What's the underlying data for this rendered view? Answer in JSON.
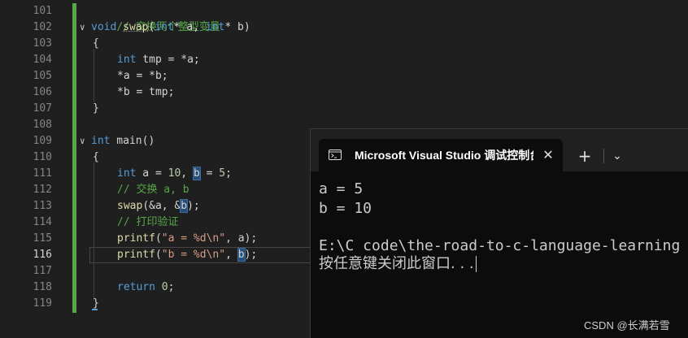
{
  "editor": {
    "line_numbers": [
      "101",
      "102",
      "103",
      "104",
      "105",
      "106",
      "107",
      "108",
      "109",
      "110",
      "111",
      "112",
      "113",
      "114",
      "115",
      "116",
      "117",
      "118",
      "119"
    ],
    "active_line": "116",
    "lines": {
      "l101": {
        "comment": "// 交换两个整型变量"
      },
      "l102": {
        "kw": "void",
        "fn": "swap",
        "params_open": "(",
        "kw2": "int",
        "p1": "* a, ",
        "kw3": "int",
        "p2": "* b)"
      },
      "l103": "{",
      "l104": {
        "kw": "int",
        "rest": " tmp = *a;"
      },
      "l105": "*a = *b;",
      "l106": "*b = tmp;",
      "l107": "}",
      "l109": {
        "kw": "int",
        "rest": " main()"
      },
      "l110": "{",
      "l111": {
        "kw": "int",
        "a_decl": " a = ",
        "num10": "10",
        "sep": ", ",
        "b_var": "b",
        "eq": " = ",
        "num5": "5",
        "end": ";"
      },
      "l112": {
        "comment": "// 交换 a, b"
      },
      "l113": {
        "fn": "swap",
        "open": "(&a, &",
        "b_var": "b",
        "close": ");"
      },
      "l114": {
        "comment": "// 打印验证"
      },
      "l115": {
        "fn": "printf",
        "open": "(",
        "str": "\"a = %d\\n\"",
        "close": ", a);"
      },
      "l116": {
        "fn": "printf",
        "open": "(",
        "str": "\"b = %d\\n\"",
        "sep": ", ",
        "b_var": "b",
        "close": ");"
      },
      "l118": {
        "kw": "return",
        "sep": " ",
        "num": "0",
        "end": ";"
      },
      "l119": "}"
    },
    "colors": {
      "background": "#1f1f1f",
      "change_bar": "#57a64a",
      "keyword": "#569cd6",
      "function": "#dcdcaa",
      "comment": "#57a64a",
      "string": "#d69d85"
    }
  },
  "console": {
    "tab_icon": "terminal-icon",
    "tab_title": "Microsoft Visual Studio 调试控制台",
    "close_glyph": "✕",
    "new_tab_glyph": "+",
    "dropdown_glyph": "⌄",
    "output": [
      "a = 5",
      "b = 10",
      "",
      "E:\\C code\\the-road-to-c-language-learning",
      "按任意键关闭此窗口. . ."
    ]
  },
  "watermark": "CSDN @长满若雪"
}
